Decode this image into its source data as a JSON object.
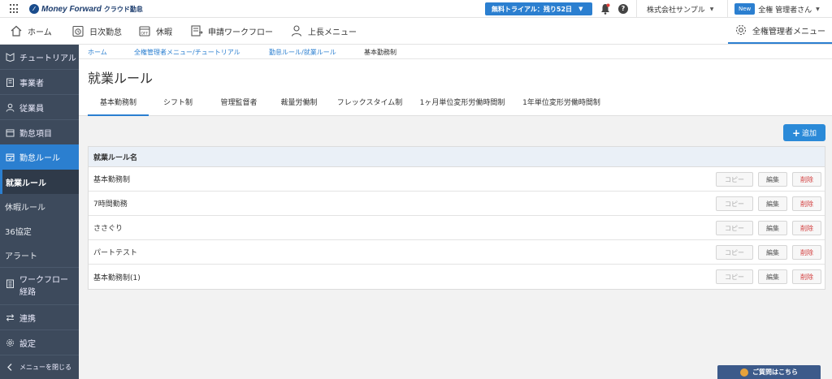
{
  "topbar": {
    "brand": "Money Forward",
    "product": "クラウド勤怠",
    "trial_label": "無料トライアル：残り52日",
    "company": "株式会社サンプル",
    "new_badge": "New",
    "user_name": "全権 管理者さん"
  },
  "nav": {
    "items": [
      {
        "label": "ホーム",
        "icon": "home-icon"
      },
      {
        "label": "日次勤怠",
        "icon": "clock-icon"
      },
      {
        "label": "休暇",
        "icon": "calendar-off-icon"
      },
      {
        "label": "申請ワークフロー",
        "icon": "workflow-icon"
      },
      {
        "label": "上長メニュー",
        "icon": "person-icon"
      }
    ],
    "admin_label": "全権管理者メニュー"
  },
  "sidebar": {
    "items": [
      {
        "label": "チュートリアル",
        "icon": "tutorial-icon"
      },
      {
        "label": "事業者",
        "icon": "building-icon"
      },
      {
        "label": "従業員",
        "icon": "person-icon"
      },
      {
        "label": "勤怠項目",
        "icon": "calendar-icon"
      },
      {
        "label": "勤怠ルール",
        "icon": "calendar-check-icon"
      }
    ],
    "sub_items": [
      {
        "label": "就業ルール"
      },
      {
        "label": "休暇ルール"
      },
      {
        "label": "36協定"
      },
      {
        "label": "アラート"
      }
    ],
    "workflow_route_line1": "ワークフロー",
    "workflow_route_line2": "経路",
    "integration": "連携",
    "settings": "設定",
    "close_menu": "メニューを閉じる"
  },
  "breadcrumb": [
    "ホーム",
    "全権管理者メニュー/チュートリアル",
    "勤怠ルール/就業ルール",
    "基本勤務制"
  ],
  "page": {
    "title": "就業ルール",
    "tabs": [
      "基本勤務制",
      "シフト制",
      "管理監督者",
      "裁量労働制",
      "フレックスタイム制",
      "1ヶ月単位変形労働時間制",
      "1年単位変形労働時間制"
    ],
    "active_tab": "基本勤務制"
  },
  "actions": {
    "add_label": "追加"
  },
  "table": {
    "header": "就業ルール名",
    "rows": [
      "基本勤務制",
      "7時間勤務",
      "ささぐり",
      "パートテスト",
      "基本勤務制(1)"
    ],
    "copy_label": "コピー",
    "edit_label": "編集",
    "delete_label": "削除"
  },
  "help_widget": {
    "label": "ご質問はこちら"
  },
  "colors": {
    "accent": "#2b7fd0",
    "sidebar": "#3d4a5c",
    "danger": "#d23a3a"
  }
}
